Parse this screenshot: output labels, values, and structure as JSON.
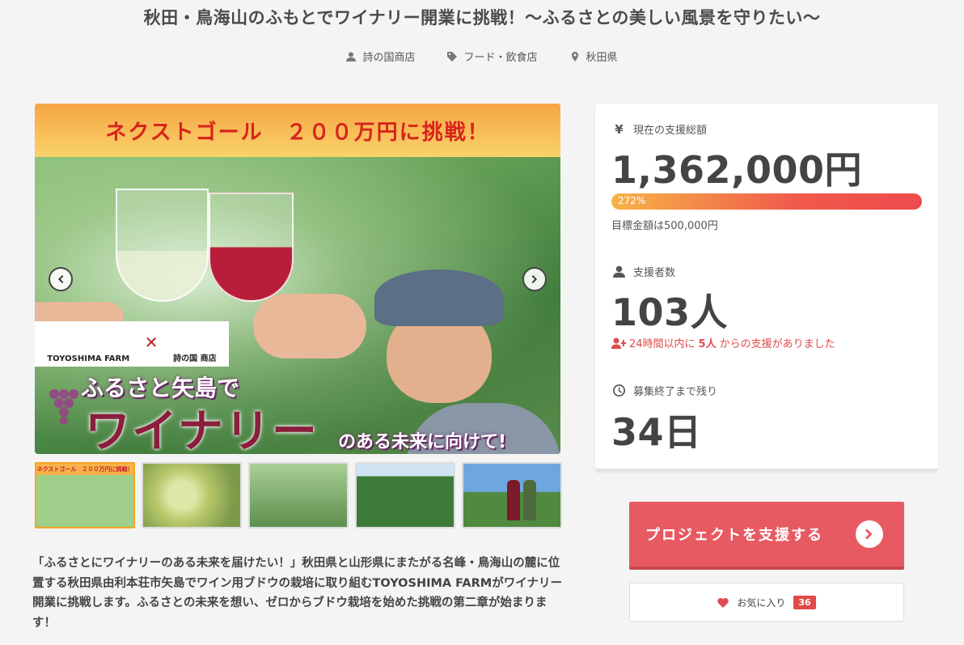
{
  "project": {
    "title": "秋田・鳥海山のふもとでワイナリー開業に挑戦！〜ふるさとの美しい風景を守りたい〜",
    "owner": "詩の国商店",
    "category": "フード・飲食店",
    "location": "秋田県",
    "description": "「ふるさとにワイナリーのある未来を届けたい！」秋田県と山形県にまたがる名峰・鳥海山の麓に位置する秋田県由利本荘市矢島でワイン用ブドウの栽培に取り組むTOYOSHIMA FARMがワイナリー開業に挑戦します。ふるさとの未来を想い、ゼロからブドウ栽培を始めた挑戦の第二章が始まります！"
  },
  "hero": {
    "banner": "ネクストゴール　２００万円に挑戦！",
    "logo_left": "TOYOSHIMA FARM",
    "logo_x": "✕",
    "logo_right": "詩の国 商店",
    "text_line1": "ふるさと矢島で",
    "text_line2": "ワイナリー",
    "text_line3": "のある未来に向けて!",
    "thumb1_label": "ネクストゴール　２００万円に挑戦！"
  },
  "stats": {
    "total_label": "現在の支援総額",
    "total_amount": "1,362,000円",
    "progress_text": "272%",
    "progress_fraction": 1.0,
    "goal_text": "目標金額は500,000円",
    "supporters_label": "支援者数",
    "supporters_count": "103人",
    "recent_prefix": "24時間以内に",
    "recent_count": "5人",
    "recent_suffix": "からの支援がありました",
    "remaining_label": "募集終了まで残り",
    "remaining_days": "34日"
  },
  "actions": {
    "support_label": "プロジェクトを支援する",
    "favorite_label": "お気に入り",
    "favorite_count": "36"
  },
  "colors": {
    "accent": "#e85a62",
    "alert": "#e04a4a",
    "progress_start": "#f7b347",
    "progress_end": "#ee4b4d"
  }
}
